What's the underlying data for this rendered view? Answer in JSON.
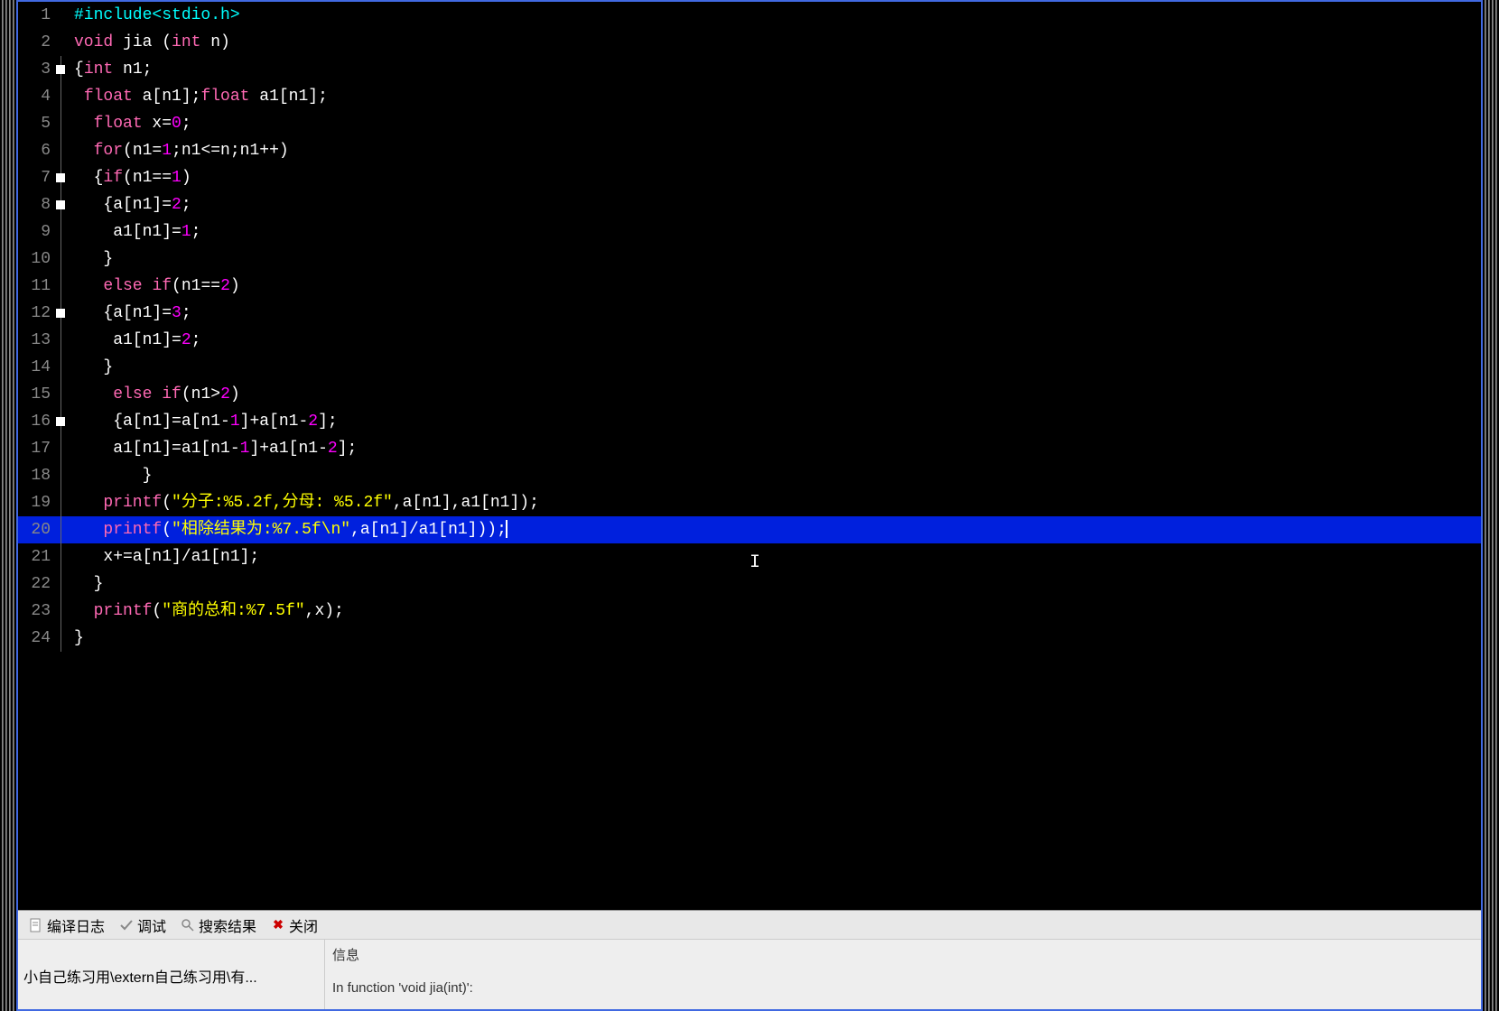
{
  "code": {
    "lines": [
      {
        "n": 1,
        "content": "#include<stdio.h>",
        "tokens": [
          {
            "t": "#include<stdio.h>",
            "cls": "kw-preproc"
          }
        ]
      },
      {
        "n": 2,
        "content": "void jia (int n)",
        "tokens": [
          {
            "t": "void",
            "cls": "kw-type"
          },
          {
            "t": " ",
            "cls": ""
          },
          {
            "t": "jia",
            "cls": "identifier"
          },
          {
            "t": " (",
            "cls": ""
          },
          {
            "t": "int",
            "cls": "kw-type"
          },
          {
            "t": " n)",
            "cls": ""
          }
        ]
      },
      {
        "n": 3,
        "content": "{int n1;",
        "fold": true,
        "tokens": [
          {
            "t": "{",
            "cls": ""
          },
          {
            "t": "int",
            "cls": "kw-type"
          },
          {
            "t": " n1;",
            "cls": ""
          }
        ]
      },
      {
        "n": 4,
        "content": " float a[n1];float a1[n1];",
        "tokens": [
          {
            "t": " ",
            "cls": ""
          },
          {
            "t": "float",
            "cls": "kw-type"
          },
          {
            "t": " a[n1];",
            "cls": ""
          },
          {
            "t": "float",
            "cls": "kw-type"
          },
          {
            "t": " a1[n1];",
            "cls": ""
          }
        ]
      },
      {
        "n": 5,
        "content": "  float x=0;",
        "tokens": [
          {
            "t": "  ",
            "cls": ""
          },
          {
            "t": "float",
            "cls": "kw-type"
          },
          {
            "t": " x=",
            "cls": ""
          },
          {
            "t": "0",
            "cls": "number"
          },
          {
            "t": ";",
            "cls": ""
          }
        ]
      },
      {
        "n": 6,
        "content": "  for(n1=1;n1<=n;n1++)",
        "tokens": [
          {
            "t": "  ",
            "cls": ""
          },
          {
            "t": "for",
            "cls": "kw-control"
          },
          {
            "t": "(n1=",
            "cls": ""
          },
          {
            "t": "1",
            "cls": "number"
          },
          {
            "t": ";n1<=n;n1++)",
            "cls": ""
          }
        ]
      },
      {
        "n": 7,
        "content": "  {if(n1==1)",
        "fold": true,
        "tokens": [
          {
            "t": "  {",
            "cls": ""
          },
          {
            "t": "if",
            "cls": "kw-control"
          },
          {
            "t": "(n1==",
            "cls": ""
          },
          {
            "t": "1",
            "cls": "number"
          },
          {
            "t": ")",
            "cls": ""
          }
        ]
      },
      {
        "n": 8,
        "content": "   {a[n1]=2;",
        "fold": true,
        "tokens": [
          {
            "t": "   {a[n1]=",
            "cls": ""
          },
          {
            "t": "2",
            "cls": "number"
          },
          {
            "t": ";",
            "cls": ""
          }
        ]
      },
      {
        "n": 9,
        "content": "    a1[n1]=1;",
        "tokens": [
          {
            "t": "    a1[n1]=",
            "cls": ""
          },
          {
            "t": "1",
            "cls": "number"
          },
          {
            "t": ";",
            "cls": ""
          }
        ]
      },
      {
        "n": 10,
        "content": "   }",
        "tokens": [
          {
            "t": "   }",
            "cls": ""
          }
        ]
      },
      {
        "n": 11,
        "content": "   else if(n1==2)",
        "tokens": [
          {
            "t": "   ",
            "cls": ""
          },
          {
            "t": "else",
            "cls": "kw-control"
          },
          {
            "t": " ",
            "cls": ""
          },
          {
            "t": "if",
            "cls": "kw-control"
          },
          {
            "t": "(n1==",
            "cls": ""
          },
          {
            "t": "2",
            "cls": "number"
          },
          {
            "t": ")",
            "cls": ""
          }
        ]
      },
      {
        "n": 12,
        "content": "   {a[n1]=3;",
        "fold": true,
        "tokens": [
          {
            "t": "   {a[n1]=",
            "cls": ""
          },
          {
            "t": "3",
            "cls": "number"
          },
          {
            "t": ";",
            "cls": ""
          }
        ]
      },
      {
        "n": 13,
        "content": "    a1[n1]=2;",
        "tokens": [
          {
            "t": "    a1[n1]=",
            "cls": ""
          },
          {
            "t": "2",
            "cls": "number"
          },
          {
            "t": ";",
            "cls": ""
          }
        ]
      },
      {
        "n": 14,
        "content": "   }",
        "tokens": [
          {
            "t": "   }",
            "cls": ""
          }
        ]
      },
      {
        "n": 15,
        "content": "    else if(n1>2)",
        "tokens": [
          {
            "t": "    ",
            "cls": ""
          },
          {
            "t": "else",
            "cls": "kw-control"
          },
          {
            "t": " ",
            "cls": ""
          },
          {
            "t": "if",
            "cls": "kw-control"
          },
          {
            "t": "(n1>",
            "cls": ""
          },
          {
            "t": "2",
            "cls": "number"
          },
          {
            "t": ")",
            "cls": ""
          }
        ]
      },
      {
        "n": 16,
        "content": "    {a[n1]=a[n1-1]+a[n1-2];",
        "fold": true,
        "tokens": [
          {
            "t": "    {a[n1]=a[n1-",
            "cls": ""
          },
          {
            "t": "1",
            "cls": "number"
          },
          {
            "t": "]+a[n1-",
            "cls": ""
          },
          {
            "t": "2",
            "cls": "number"
          },
          {
            "t": "];",
            "cls": ""
          }
        ]
      },
      {
        "n": 17,
        "content": "    a1[n1]=a1[n1-1]+a1[n1-2];",
        "tokens": [
          {
            "t": "    a1[n1]=a1[n1-",
            "cls": ""
          },
          {
            "t": "1",
            "cls": "number"
          },
          {
            "t": "]+a1[n1-",
            "cls": ""
          },
          {
            "t": "2",
            "cls": "number"
          },
          {
            "t": "];",
            "cls": ""
          }
        ]
      },
      {
        "n": 18,
        "content": "       }",
        "tokens": [
          {
            "t": "       }",
            "cls": ""
          }
        ]
      },
      {
        "n": 19,
        "content": "   printf(\"分子:%5.2f,分母: %5.2f\",a[n1],a1[n1]);",
        "tokens": [
          {
            "t": "   ",
            "cls": ""
          },
          {
            "t": "printf",
            "cls": "kw-func"
          },
          {
            "t": "(",
            "cls": ""
          },
          {
            "t": "\"分子:%5.2f,分母: %5.2f\"",
            "cls": "string"
          },
          {
            "t": ",a[n1],a1[n1]);",
            "cls": ""
          }
        ]
      },
      {
        "n": 20,
        "content": "   printf(\"相除结果为:%7.5f\\n\",a[n1]/a1[n1]));",
        "current": true,
        "tokens": [
          {
            "t": "   ",
            "cls": ""
          },
          {
            "t": "printf",
            "cls": "kw-func"
          },
          {
            "t": "(",
            "cls": ""
          },
          {
            "t": "\"相除结果为:%7.5f\\n\"",
            "cls": "string"
          },
          {
            "t": ",a[n1]/a1[n1]));",
            "cls": ""
          }
        ]
      },
      {
        "n": 21,
        "content": "   x+=a[n1]/a1[n1];",
        "tokens": [
          {
            "t": "   x+=a[n1]/a1[n1];",
            "cls": ""
          }
        ]
      },
      {
        "n": 22,
        "content": "  }",
        "tokens": [
          {
            "t": "  }",
            "cls": ""
          }
        ]
      },
      {
        "n": 23,
        "content": "  printf(\"商的总和:%7.5f\",x);",
        "tokens": [
          {
            "t": "  ",
            "cls": ""
          },
          {
            "t": "printf",
            "cls": "kw-func"
          },
          {
            "t": "(",
            "cls": ""
          },
          {
            "t": "\"商的总和:%7.5f\"",
            "cls": "string"
          },
          {
            "t": ",x);",
            "cls": ""
          }
        ]
      },
      {
        "n": 24,
        "content": "}",
        "tokens": [
          {
            "t": "}",
            "cls": ""
          }
        ]
      }
    ]
  },
  "tabs": {
    "compile_log": "编译日志",
    "debug": "调试",
    "search_results": "搜索结果",
    "close": "关闭"
  },
  "messages": {
    "file_path": "小自己练习用\\extern自己练习用\\有...",
    "info_header": "信息",
    "error_text": "In function 'void jia(int)':"
  }
}
